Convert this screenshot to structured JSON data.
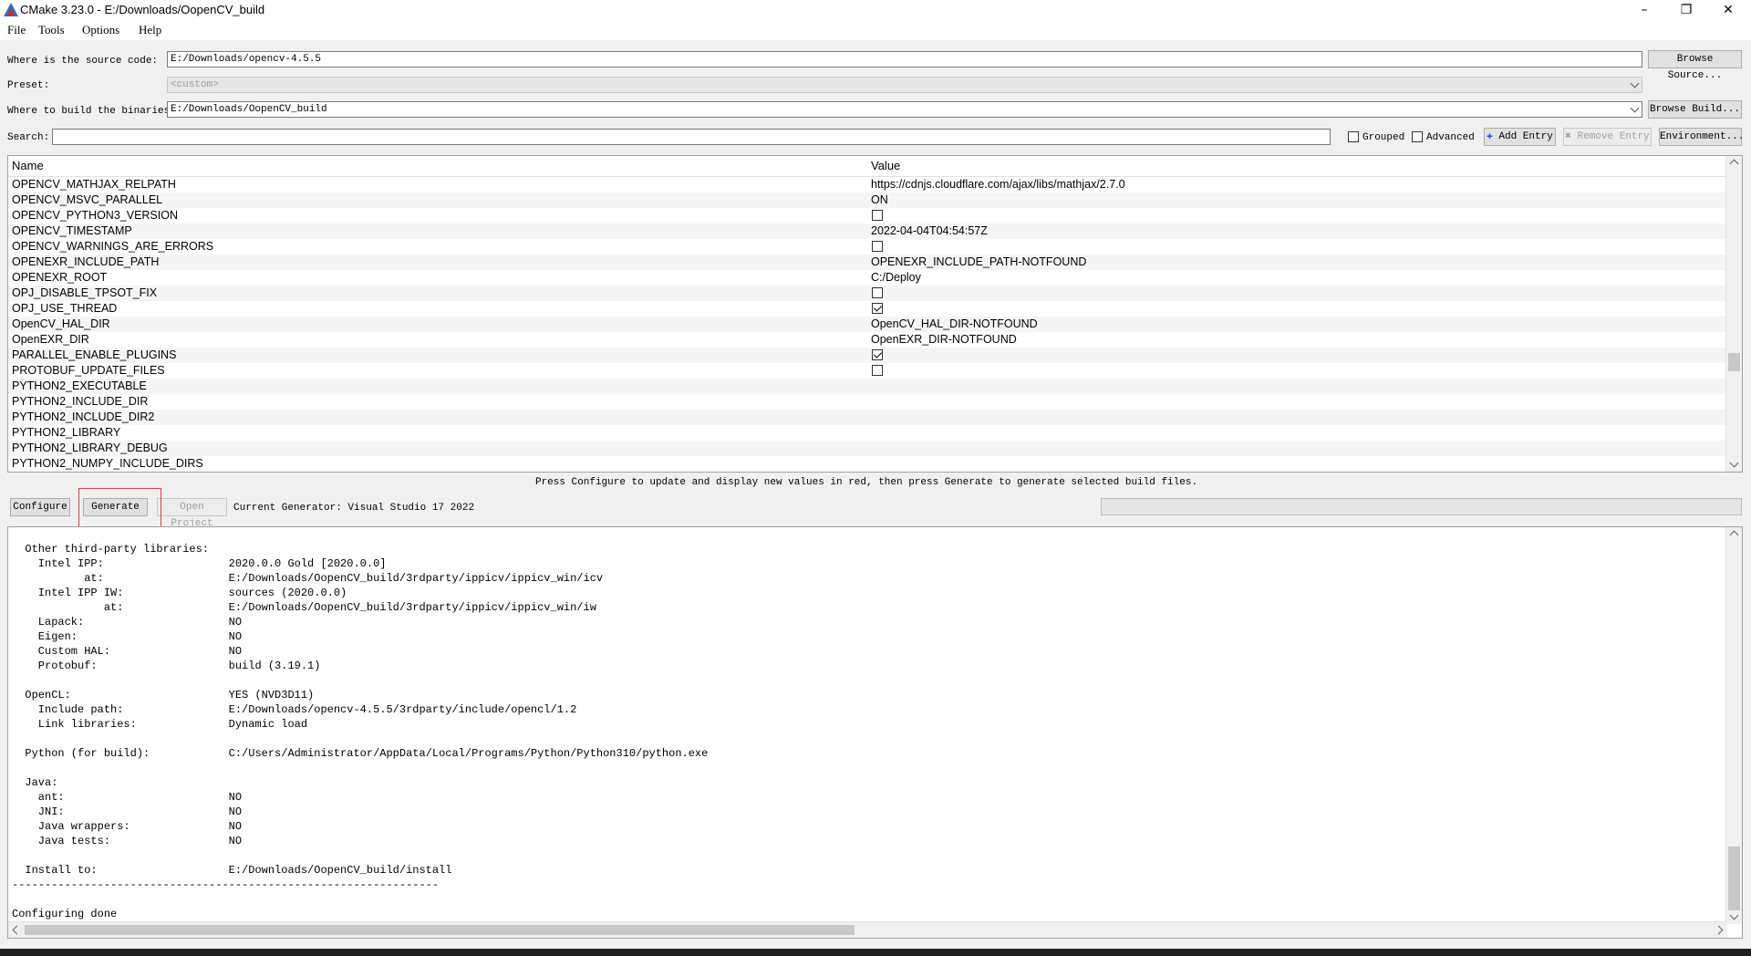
{
  "window": {
    "title": "CMake 3.23.0 - E:/Downloads/OopenCV_build",
    "minimize": "–",
    "maximize": "❐",
    "close": "✕"
  },
  "menu": [
    "File",
    "Tools",
    "Options",
    "Help"
  ],
  "source": {
    "label": "Where is the source code:",
    "value": "E:/Downloads/opencv-4.5.5",
    "button": "Browse Source..."
  },
  "preset": {
    "label": "Preset:",
    "value": "<custom>"
  },
  "build": {
    "label": "Where to build the binaries:",
    "value": "E:/Downloads/OopenCV_build",
    "button": "Browse Build..."
  },
  "search": {
    "label": "Search:",
    "value": ""
  },
  "options": {
    "grouped": "Grouped",
    "advanced": "Advanced",
    "add_entry": "Add Entry",
    "remove_entry": "Remove Entry",
    "environment": "Environment..."
  },
  "table": {
    "headers": {
      "name": "Name",
      "value": "Value"
    },
    "rows": [
      {
        "name": "OPENCV_MATHJAX_RELPATH",
        "value": "https://cdnjs.cloudflare.com/ajax/libs/mathjax/2.7.0",
        "type": "text"
      },
      {
        "name": "OPENCV_MSVC_PARALLEL",
        "value": "ON",
        "type": "text"
      },
      {
        "name": "OPENCV_PYTHON3_VERSION",
        "value": "",
        "type": "checkbox",
        "checked": false
      },
      {
        "name": "OPENCV_TIMESTAMP",
        "value": "2022-04-04T04:54:57Z",
        "type": "text"
      },
      {
        "name": "OPENCV_WARNINGS_ARE_ERRORS",
        "value": "",
        "type": "checkbox",
        "checked": false
      },
      {
        "name": "OPENEXR_INCLUDE_PATH",
        "value": "OPENEXR_INCLUDE_PATH-NOTFOUND",
        "type": "text"
      },
      {
        "name": "OPENEXR_ROOT",
        "value": "C:/Deploy",
        "type": "text"
      },
      {
        "name": "OPJ_DISABLE_TPSOT_FIX",
        "value": "",
        "type": "checkbox",
        "checked": false
      },
      {
        "name": "OPJ_USE_THREAD",
        "value": "",
        "type": "checkbox",
        "checked": true
      },
      {
        "name": "OpenCV_HAL_DIR",
        "value": "OpenCV_HAL_DIR-NOTFOUND",
        "type": "text"
      },
      {
        "name": "OpenEXR_DIR",
        "value": "OpenEXR_DIR-NOTFOUND",
        "type": "text"
      },
      {
        "name": "PARALLEL_ENABLE_PLUGINS",
        "value": "",
        "type": "checkbox",
        "checked": true
      },
      {
        "name": "PROTOBUF_UPDATE_FILES",
        "value": "",
        "type": "checkbox",
        "checked": false
      },
      {
        "name": "PYTHON2_EXECUTABLE",
        "value": "",
        "type": "text"
      },
      {
        "name": "PYTHON2_INCLUDE_DIR",
        "value": "",
        "type": "text"
      },
      {
        "name": "PYTHON2_INCLUDE_DIR2",
        "value": "",
        "type": "text"
      },
      {
        "name": "PYTHON2_LIBRARY",
        "value": "",
        "type": "text"
      },
      {
        "name": "PYTHON2_LIBRARY_DEBUG",
        "value": "",
        "type": "text"
      },
      {
        "name": "PYTHON2_NUMPY_INCLUDE_DIRS",
        "value": "",
        "type": "text"
      }
    ]
  },
  "hint": "Press Configure to update and display new values in red, then press Generate to generate selected build files.",
  "actions": {
    "configure": "Configure",
    "generate": "Generate",
    "open_project": "Open Project",
    "generator": "Current Generator: Visual Studio 17 2022"
  },
  "output": {
    "lines": [
      "  Other third-party libraries:",
      "    Intel IPP:                   2020.0.0 Gold [2020.0.0]",
      "           at:                   E:/Downloads/OopenCV_build/3rdparty/ippicv/ippicv_win/icv",
      "    Intel IPP IW:                sources (2020.0.0)",
      "              at:                E:/Downloads/OopenCV_build/3rdparty/ippicv/ippicv_win/iw",
      "    Lapack:                      NO",
      "    Eigen:                       NO",
      "    Custom HAL:                  NO",
      "    Protobuf:                    build (3.19.1)",
      "",
      "  OpenCL:                        YES (NVD3D11)",
      "    Include path:                E:/Downloads/opencv-4.5.5/3rdparty/include/opencl/1.2",
      "    Link libraries:              Dynamic load",
      "",
      "  Python (for build):            C:/Users/Administrator/AppData/Local/Programs/Python/Python310/python.exe",
      "",
      "  Java:",
      "    ant:                         NO",
      "    JNI:                         NO",
      "    Java wrappers:               NO",
      "    Java tests:                  NO",
      "",
      "  Install to:                    E:/Downloads/OopenCV_build/install",
      "-----------------------------------------------------------------",
      "",
      "Configuring done"
    ]
  }
}
